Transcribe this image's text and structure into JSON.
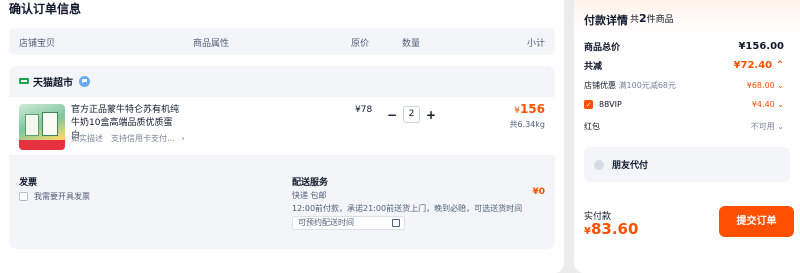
{
  "order": {
    "title": "确认订单信息",
    "table_headers": [
      "店铺宝贝",
      "商品属性",
      "原价",
      "数量",
      "小计"
    ],
    "store": {
      "name": "天猫超市",
      "item": {
        "title": "官方正品蒙牛特仑苏有机纯牛奶10盒高端品质优质蛋白",
        "sub": "如实描述　支持信用卡支付…",
        "unit_price": "¥78",
        "quantity": "2",
        "line_total_symbol": "¥",
        "line_total": "156",
        "weight": "共6.34kg"
      }
    },
    "invoice": {
      "title": "发票",
      "option": "我需要开具发票"
    },
    "shipping": {
      "title": "配送服务",
      "line1": "快递 包邮",
      "line2": "12:00前付款，承诺21:00前送货上门，晚到必赔，可选送货时间",
      "time_placeholder": "可预约配送时间",
      "fee": "¥0"
    }
  },
  "payment": {
    "title": "付款详情",
    "count_prefix": "共",
    "count": "2",
    "count_suffix": "件商品",
    "goods_total_label": "商品总价",
    "goods_total": "¥156.00",
    "discount_label": "共减",
    "discount_total": "¥72.40",
    "store_coupon_label": "店铺优惠",
    "store_coupon_desc": "满100元减68元",
    "store_coupon_value": "¥68.00",
    "vip_label": "88VIP",
    "vip_value": "¥4.40",
    "redpacket_label": "红包",
    "redpacket_value": "不可用",
    "friend_pay": "朋友代付",
    "actual_label": "实付款",
    "actual_symbol": "¥",
    "actual_value": "83.60",
    "submit_label": "提交订单"
  },
  "colors": {
    "accent": "#ff5000",
    "panel_bg": "#f4f5f8"
  }
}
